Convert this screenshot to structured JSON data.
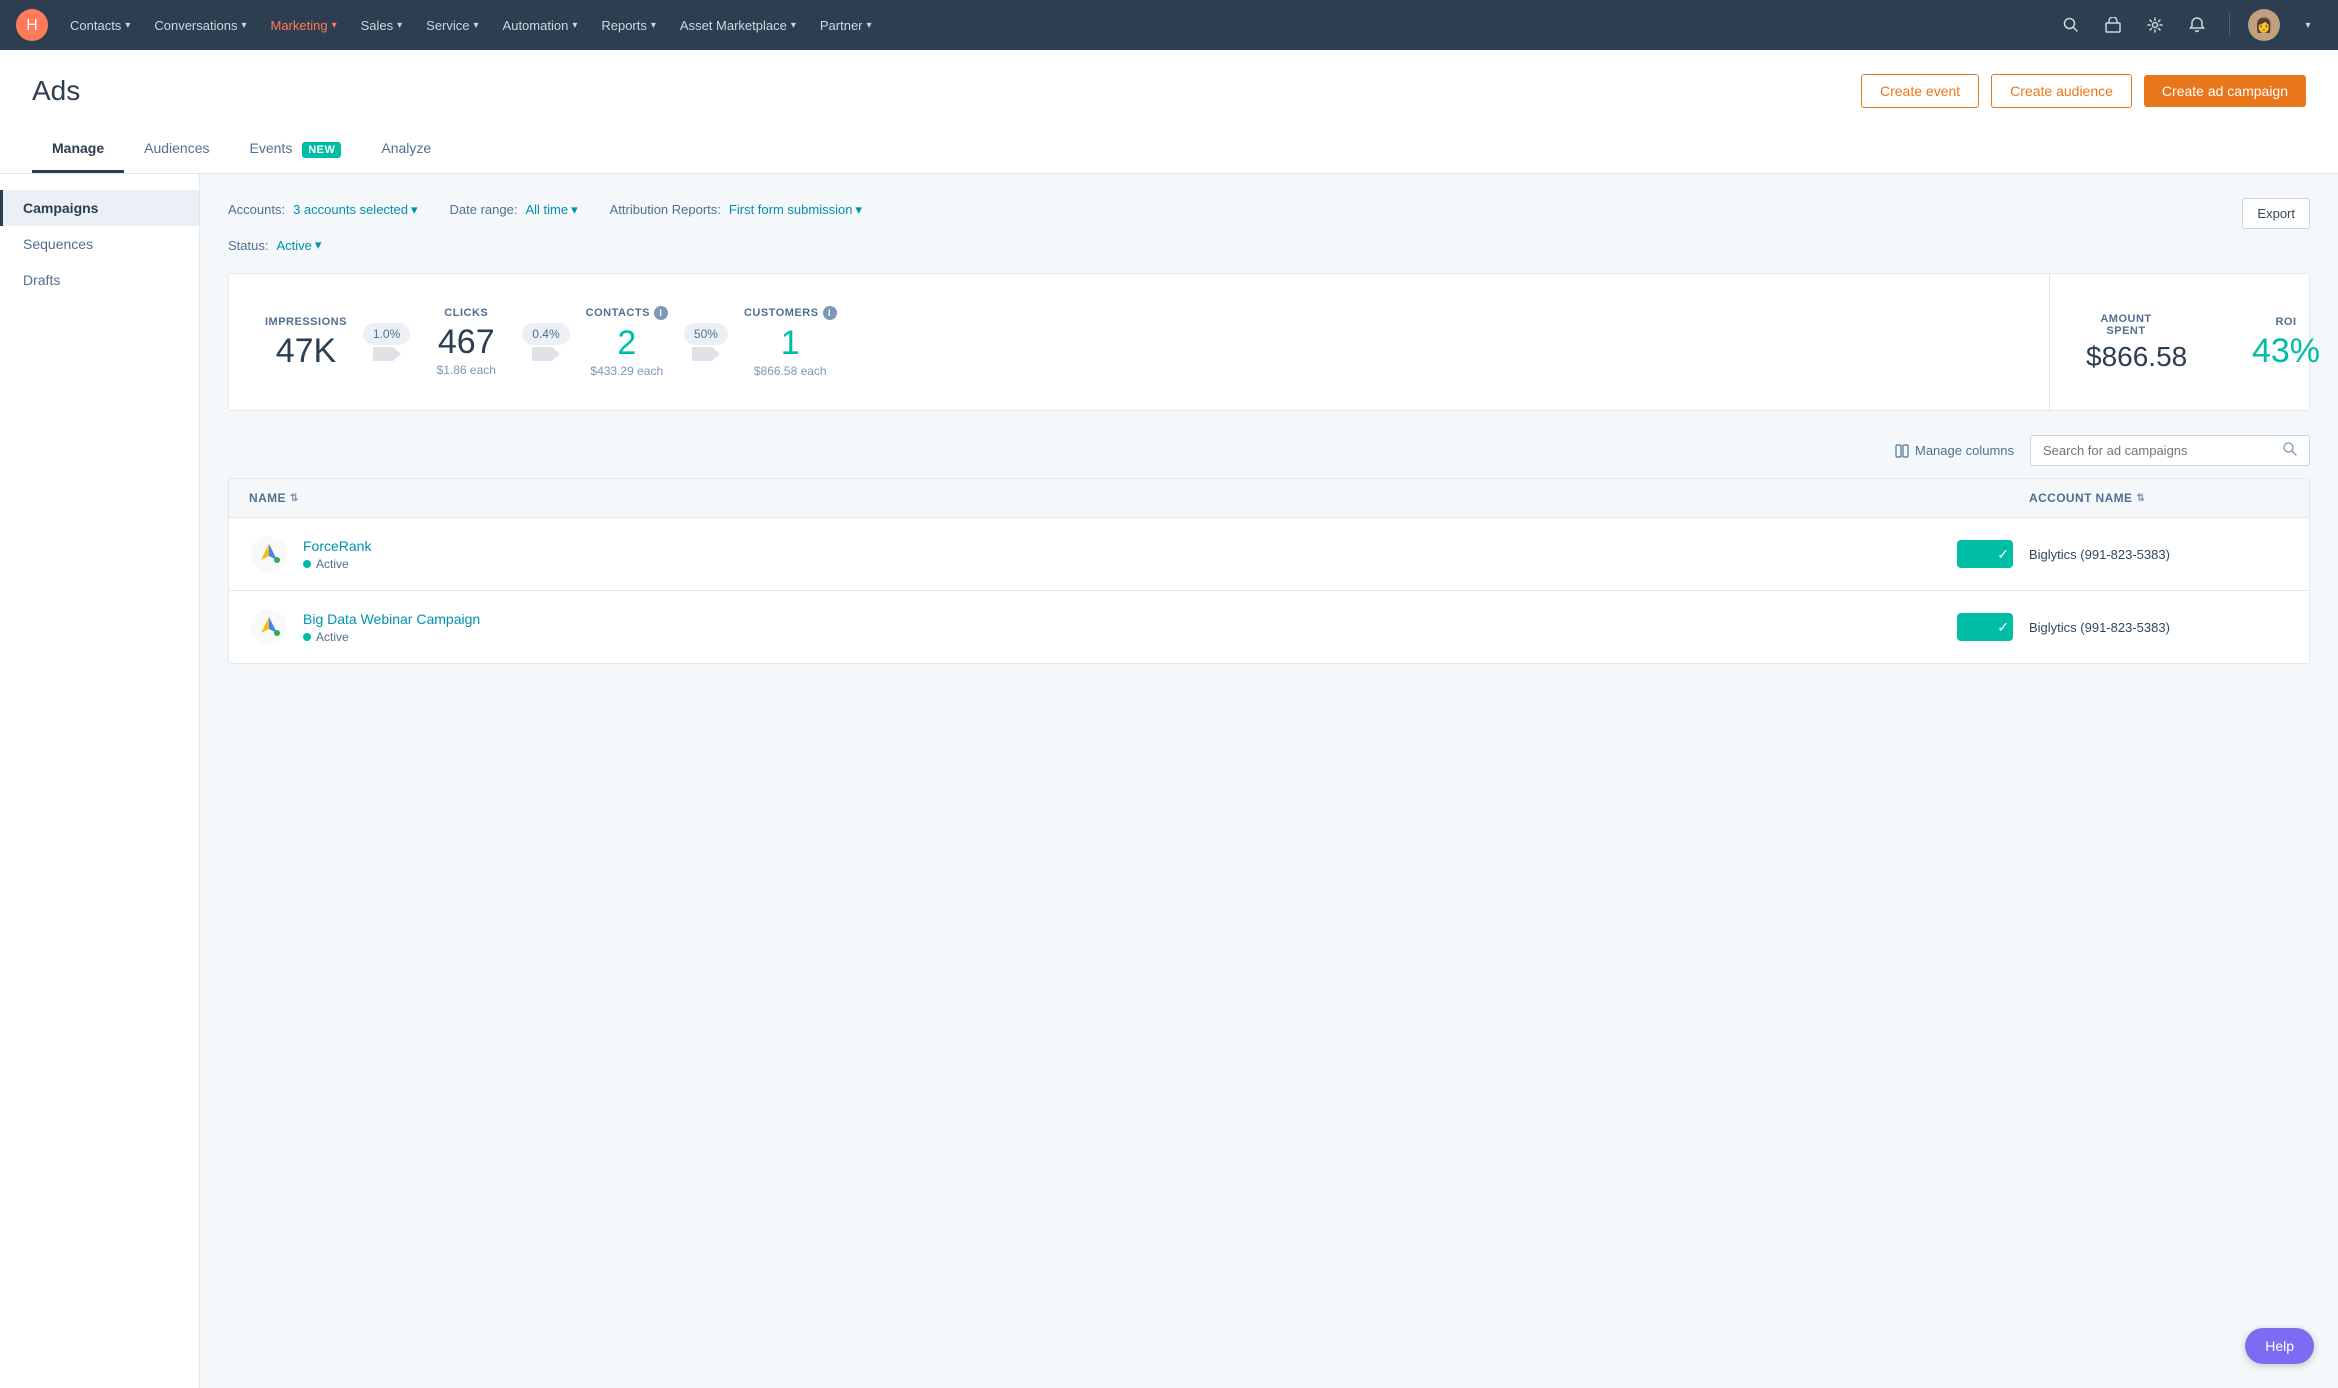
{
  "nav": {
    "logo": "🟠",
    "items": [
      {
        "label": "Contacts",
        "id": "contacts"
      },
      {
        "label": "Conversations",
        "id": "conversations"
      },
      {
        "label": "Marketing",
        "id": "marketing"
      },
      {
        "label": "Sales",
        "id": "sales"
      },
      {
        "label": "Service",
        "id": "service"
      },
      {
        "label": "Automation",
        "id": "automation"
      },
      {
        "label": "Reports",
        "id": "reports"
      },
      {
        "label": "Asset Marketplace",
        "id": "asset-marketplace"
      },
      {
        "label": "Partner",
        "id": "partner"
      }
    ],
    "icons": [
      "search",
      "store",
      "settings",
      "bell"
    ]
  },
  "page": {
    "title": "Ads",
    "tabs": [
      {
        "label": "Manage",
        "id": "manage",
        "active": true
      },
      {
        "label": "Audiences",
        "id": "audiences"
      },
      {
        "label": "Events",
        "id": "events",
        "badge": "NEW"
      },
      {
        "label": "Analyze",
        "id": "analyze"
      }
    ]
  },
  "actions": {
    "create_event": "Create event",
    "create_audience": "Create audience",
    "create_campaign": "Create ad campaign",
    "export": "Export"
  },
  "sidebar": {
    "items": [
      {
        "label": "Campaigns",
        "id": "campaigns",
        "active": true
      },
      {
        "label": "Sequences",
        "id": "sequences"
      },
      {
        "label": "Drafts",
        "id": "drafts"
      }
    ]
  },
  "filters": {
    "accounts_label": "Accounts:",
    "accounts_value": "3 accounts selected",
    "date_range_label": "Date range:",
    "date_range_value": "All time",
    "attribution_label": "Attribution Reports:",
    "attribution_value": "First form submission",
    "status_label": "Status:",
    "status_value": "Active"
  },
  "stats": {
    "impressions": {
      "label": "IMPRESSIONS",
      "value": "47K"
    },
    "arrow1": {
      "pct": "1.0%"
    },
    "clicks": {
      "label": "CLICKS",
      "value": "467",
      "sub": "$1.86 each"
    },
    "arrow2": {
      "pct": "0.4%"
    },
    "contacts": {
      "label": "CONTACTS",
      "value": "2",
      "sub": "$433.29 each"
    },
    "arrow3": {
      "pct": "50%"
    },
    "customers": {
      "label": "CUSTOMERS",
      "value": "1",
      "sub": "$866.58 each"
    },
    "amount_spent": {
      "label": "AMOUNT SPENT",
      "value": "$866.58"
    },
    "roi": {
      "label": "ROI",
      "value": "43%"
    }
  },
  "table_controls": {
    "manage_columns": "Manage columns",
    "search_placeholder": "Search for ad campaigns"
  },
  "table": {
    "headers": [
      {
        "label": "NAME",
        "id": "name"
      },
      {
        "label": "ACCOUNT NAME",
        "id": "account"
      }
    ],
    "rows": [
      {
        "name": "ForceRank",
        "status": "Active",
        "account": "Biglytics (991-823-5383)",
        "logo_type": "google-ads"
      },
      {
        "name": "Big Data Webinar Campaign",
        "status": "Active",
        "account": "Biglytics (991-823-5383)",
        "logo_type": "google-ads"
      }
    ]
  },
  "help": {
    "label": "Help"
  },
  "colors": {
    "teal": "#00bda5",
    "orange": "#e8761a",
    "blue": "#0091ae",
    "purple": "#7c6cf2",
    "nav_bg": "#2d3e50"
  }
}
